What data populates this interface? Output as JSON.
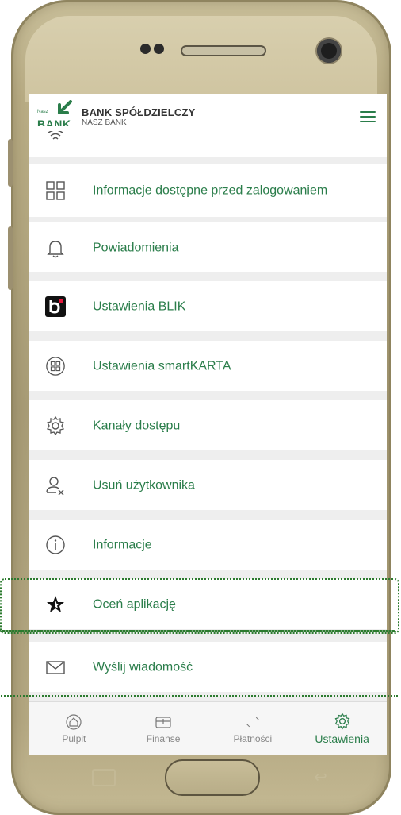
{
  "header": {
    "logo_small": "Nasz",
    "logo_text": "BANK",
    "bank_name": "BANK SPÓŁDZIELCZY",
    "bank_sub": "NASZ BANK",
    "menu_icon": "hamburger-menu-icon"
  },
  "menu": {
    "items": [
      {
        "label": "",
        "icon": "fingerprint-icon"
      },
      {
        "label": "Informacje dostępne przed zalogowaniem",
        "icon": "grid-icon"
      },
      {
        "label": "Powiadomienia",
        "icon": "bell-icon"
      },
      {
        "label": "Ustawienia BLIK",
        "icon": "blik-icon"
      },
      {
        "label": "Ustawienia smartKARTA",
        "icon": "smartkarta-icon"
      },
      {
        "label": "Kanały dostępu",
        "icon": "gear-icon"
      },
      {
        "label": "Usuń użytkownika",
        "icon": "remove-user-icon"
      },
      {
        "label": "Informacje",
        "icon": "info-icon"
      },
      {
        "label": "Oceń aplikację",
        "icon": "star-icon"
      },
      {
        "label": "Wyślij wiadomość",
        "icon": "envelope-icon"
      }
    ]
  },
  "bottom_nav": [
    {
      "label": "Pulpit",
      "icon": "home-icon",
      "active": false
    },
    {
      "label": "Finanse",
      "icon": "wallet-icon",
      "active": false
    },
    {
      "label": "Płatności",
      "icon": "transfer-arrows-icon",
      "active": false
    },
    {
      "label": "Ustawienia",
      "icon": "gear-icon",
      "active": true
    }
  ],
  "colors": {
    "accent": "#2a7d4a",
    "highlight": "#2b7a2e",
    "background": "#eeeeee"
  }
}
